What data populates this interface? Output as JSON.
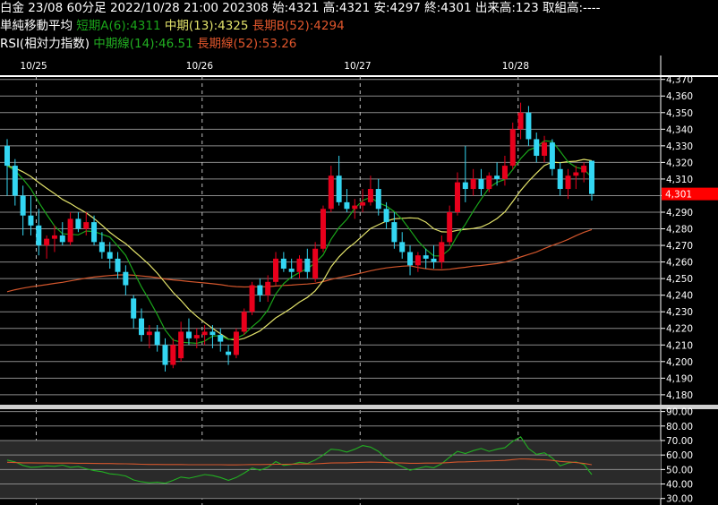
{
  "header": {
    "line1": "白金 23/08 60分足 2022/10/28 21:00 202308 始:4321 高:4321 安:4297 終:4301 出来高:123 取組高:----",
    "ma_title": "単純移動平均",
    "ma_short": "短期A(6):4311",
    "ma_mid": "中期(13):4325",
    "ma_long": "長期B(52):4294",
    "rsi_title": "RSI(相対力指数)",
    "rsi_mid": "中期線(14):46.51",
    "rsi_long": "長期線(52):53.26"
  },
  "colors": {
    "up": "#e8001c",
    "down": "#33d6f2",
    "ma_short": "#1aa51a",
    "ma_mid": "#e2e26a",
    "ma_long": "#d2562c",
    "rsi_mid": "#22b022",
    "rsi_long": "#d2562c",
    "last_price_bg": "#ff0000"
  },
  "chart_data": [
    {
      "type": "candlestick",
      "x_labels": [
        "10/25",
        "10/26",
        "10/27",
        "10/28"
      ],
      "y_ticks": [
        4180,
        4190,
        4200,
        4210,
        4220,
        4230,
        4240,
        4250,
        4260,
        4270,
        4280,
        4290,
        4300,
        4310,
        4320,
        4330,
        4340,
        4350,
        4360,
        4370
      ],
      "ylim": [
        4174,
        4372
      ],
      "last_price_label": "4,301",
      "last_price": 4301,
      "candles": [
        [
          4330,
          4334,
          4300,
          4318
        ],
        [
          4318,
          4322,
          4294,
          4300
        ],
        [
          4300,
          4306,
          4276,
          4288
        ],
        [
          4288,
          4300,
          4276,
          4282
        ],
        [
          4282,
          4292,
          4264,
          4270
        ],
        [
          4270,
          4276,
          4262,
          4274
        ],
        [
          4274,
          4282,
          4266,
          4276
        ],
        [
          4276,
          4284,
          4270,
          4272
        ],
        [
          4272,
          4290,
          4270,
          4286
        ],
        [
          4286,
          4290,
          4278,
          4280
        ],
        [
          4280,
          4290,
          4276,
          4284
        ],
        [
          4284,
          4288,
          4270,
          4272
        ],
        [
          4272,
          4278,
          4262,
          4266
        ],
        [
          4266,
          4272,
          4256,
          4262
        ],
        [
          4262,
          4266,
          4250,
          4254
        ],
        [
          4254,
          4258,
          4240,
          4246
        ],
        [
          4238,
          4240,
          4220,
          4226
        ],
        [
          4226,
          4232,
          4212,
          4216
        ],
        [
          4216,
          4222,
          4208,
          4218
        ],
        [
          4218,
          4222,
          4206,
          4210
        ],
        [
          4210,
          4214,
          4194,
          4198
        ],
        [
          4198,
          4214,
          4196,
          4210
        ],
        [
          4202,
          4224,
          4200,
          4218
        ],
        [
          4218,
          4226,
          4210,
          4214
        ],
        [
          4214,
          4220,
          4208,
          4216
        ],
        [
          4216,
          4222,
          4210,
          4218
        ],
        [
          4218,
          4222,
          4208,
          4216
        ],
        [
          4216,
          4220,
          4206,
          4212
        ],
        [
          4206,
          4210,
          4198,
          4204
        ],
        [
          4204,
          4220,
          4202,
          4218
        ],
        [
          4218,
          4232,
          4216,
          4230
        ],
        [
          4230,
          4248,
          4228,
          4246
        ],
        [
          4246,
          4250,
          4236,
          4240
        ],
        [
          4240,
          4252,
          4236,
          4248
        ],
        [
          4248,
          4266,
          4246,
          4262
        ],
        [
          4262,
          4266,
          4254,
          4256
        ],
        [
          4256,
          4262,
          4250,
          4254
        ],
        [
          4254,
          4264,
          4250,
          4262
        ],
        [
          4262,
          4268,
          4250,
          4254
        ],
        [
          4250,
          4272,
          4248,
          4268
        ],
        [
          4268,
          4294,
          4266,
          4292
        ],
        [
          4292,
          4318,
          4290,
          4312
        ],
        [
          4312,
          4324,
          4294,
          4296
        ],
        [
          4296,
          4304,
          4290,
          4292
        ],
        [
          4292,
          4298,
          4286,
          4294
        ],
        [
          4294,
          4304,
          4290,
          4296
        ],
        [
          4296,
          4312,
          4294,
          4304
        ],
        [
          4304,
          4310,
          4288,
          4292
        ],
        [
          4292,
          4296,
          4280,
          4284
        ],
        [
          4284,
          4290,
          4268,
          4272
        ],
        [
          4272,
          4278,
          4262,
          4266
        ],
        [
          4266,
          4270,
          4252,
          4258
        ],
        [
          4258,
          4266,
          4254,
          4264
        ],
        [
          4264,
          4268,
          4256,
          4262
        ],
        [
          4262,
          4270,
          4256,
          4260
        ],
        [
          4260,
          4276,
          4256,
          4272
        ],
        [
          4272,
          4294,
          4270,
          4290
        ],
        [
          4290,
          4314,
          4288,
          4308
        ],
        [
          4308,
          4330,
          4296,
          4304
        ],
        [
          4304,
          4316,
          4300,
          4310
        ],
        [
          4310,
          4316,
          4300,
          4304
        ],
        [
          4304,
          4314,
          4302,
          4312
        ],
        [
          4312,
          4320,
          4306,
          4310
        ],
        [
          4310,
          4324,
          4306,
          4318
        ],
        [
          4318,
          4344,
          4316,
          4340
        ],
        [
          4340,
          4356,
          4334,
          4350
        ],
        [
          4350,
          4354,
          4330,
          4334
        ],
        [
          4334,
          4338,
          4320,
          4324
        ],
        [
          4324,
          4336,
          4320,
          4332
        ],
        [
          4332,
          4334,
          4312,
          4316
        ],
        [
          4316,
          4320,
          4300,
          4304
        ],
        [
          4304,
          4316,
          4298,
          4312
        ],
        [
          4312,
          4318,
          4304,
          4314
        ],
        [
          4314,
          4320,
          4308,
          4318
        ],
        [
          4321,
          4321,
          4297,
          4301
        ]
      ]
    },
    {
      "type": "line",
      "name": "RSI",
      "y_ticks": [
        30,
        40,
        50,
        60,
        70,
        80,
        90
      ],
      "y_tick_labels": [
        "30.00",
        "40.00",
        "50.00",
        "60.00",
        "70.00",
        "80.00",
        "90.00"
      ],
      "ylim": [
        25.5,
        91
      ],
      "band": [
        30,
        70
      ],
      "series": [
        {
          "name": "中期線(14)",
          "values": [
            56.5,
            55.2,
            52.8,
            51.5,
            51.8,
            52.5,
            52.2,
            53.0,
            51.5,
            52.0,
            50.5,
            49.2,
            48.5,
            47.0,
            46.5,
            45.5,
            42.8,
            41.5,
            40.8,
            41.2,
            40.5,
            42.5,
            44.8,
            44.0,
            45.2,
            46.5,
            45.8,
            44.5,
            42.5,
            44.5,
            47.5,
            51.0,
            49.5,
            51.5,
            55.5,
            52.8,
            53.5,
            55.0,
            54.2,
            56.5,
            60.0,
            64.0,
            63.5,
            62.0,
            64.0,
            66.5,
            65.5,
            62.5,
            57.5,
            54.5,
            52.0,
            49.5,
            50.8,
            52.0,
            51.2,
            54.0,
            58.5,
            62.5,
            61.0,
            63.0,
            64.5,
            62.5,
            64.0,
            65.0,
            69.5,
            72.5,
            64.5,
            60.5,
            61.5,
            58.0,
            52.5,
            54.5,
            55.2,
            53.5,
            46.5
          ]
        },
        {
          "name": "長期線(52)",
          "values": [
            55.0,
            54.8,
            54.6,
            54.6,
            54.5,
            54.5,
            54.4,
            54.4,
            54.4,
            54.3,
            54.3,
            54.2,
            54.1,
            54.1,
            54.0,
            53.9,
            53.8,
            53.6,
            53.5,
            53.5,
            53.4,
            53.4,
            53.4,
            53.3,
            53.3,
            53.3,
            53.3,
            53.3,
            53.2,
            53.2,
            53.3,
            53.4,
            53.4,
            53.5,
            53.6,
            53.6,
            53.7,
            53.8,
            53.8,
            53.9,
            54.2,
            54.5,
            54.6,
            54.6,
            54.8,
            55.0,
            55.1,
            55.0,
            54.8,
            54.6,
            54.5,
            54.3,
            54.3,
            54.4,
            54.4,
            54.5,
            54.8,
            55.2,
            55.3,
            55.5,
            55.8,
            55.9,
            56.1,
            56.3,
            56.8,
            57.3,
            57.2,
            56.9,
            56.7,
            56.3,
            55.6,
            55.2,
            54.8,
            54.2,
            53.3
          ]
        }
      ]
    }
  ]
}
